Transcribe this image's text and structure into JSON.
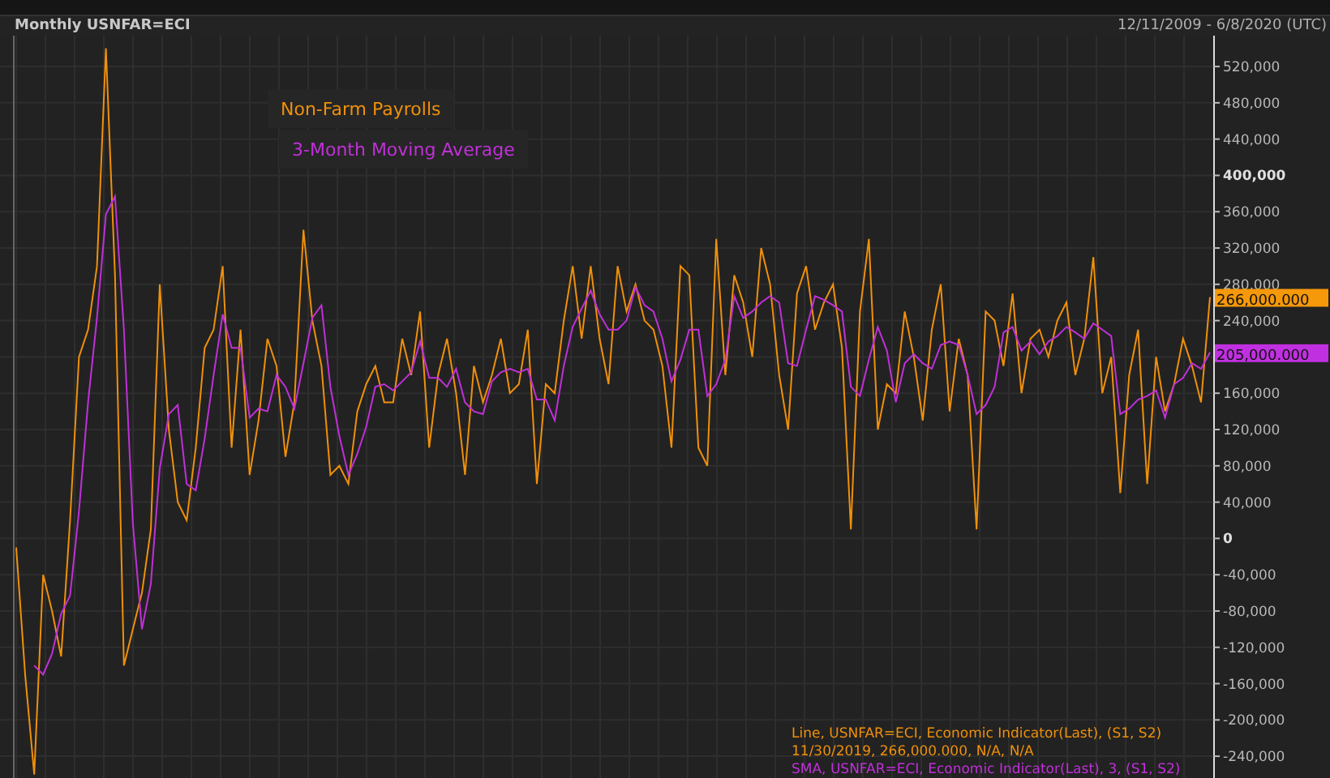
{
  "header": {
    "title": "Monthly USNFAR=ECI",
    "date_range": "12/11/2009 - 6/8/2020 (UTC)"
  },
  "chart": {
    "last_value_labels": [
      {
        "text": "266,000.000",
        "color": "#f5980a"
      },
      {
        "text": "205,000.000",
        "color": "#c030e0"
      }
    ],
    "info_lines": [
      {
        "text": "Line, USNFAR=ECI, Economic Indicator(Last), (S1, S2)",
        "color": "#f0900a"
      },
      {
        "text": "11/30/2019, 266,000.000, N/A, N/A",
        "color": "#f0900a"
      },
      {
        "text": "SMA, USNFAR=ECI, Economic Indicator(Last), 3, (S1, S2)",
        "color": "#c030d8"
      }
    ],
    "chart_data": {
      "type": "line",
      "grid": true,
      "ylim": [
        -264000,
        554000
      ],
      "yticks": [
        {
          "value": 520000,
          "label": "520,000"
        },
        {
          "value": 480000,
          "label": "480,000"
        },
        {
          "value": 440000,
          "label": "440,000"
        },
        {
          "value": 400000,
          "label": "400,000"
        },
        {
          "value": 360000,
          "label": "360,000"
        },
        {
          "value": 320000,
          "label": "320,000"
        },
        {
          "value": 280000,
          "label": "280,000"
        },
        {
          "value": 240000,
          "label": "240,000"
        },
        {
          "value": 160000,
          "label": "160,000"
        },
        {
          "value": 120000,
          "label": "120,000"
        },
        {
          "value": 80000,
          "label": "80,000"
        },
        {
          "value": 40000,
          "label": "40,000"
        },
        {
          "value": 0,
          "label": "0"
        },
        {
          "value": -40000,
          "label": "-40,000"
        },
        {
          "value": -80000,
          "label": "-80,000"
        },
        {
          "value": -120000,
          "label": "-120,000"
        },
        {
          "value": -160000,
          "label": "-160,000"
        },
        {
          "value": -200000,
          "label": "-200,000"
        },
        {
          "value": -240000,
          "label": "-240,000"
        }
      ],
      "series": [
        {
          "name": "Non-Farm Payrolls",
          "color": "#f0900a",
          "values": [
            -10000,
            -150000,
            -260000,
            -40000,
            -80000,
            -130000,
            20000,
            200000,
            230000,
            300000,
            540000,
            290000,
            -140000,
            -100000,
            -60000,
            10000,
            280000,
            120000,
            40000,
            20000,
            100000,
            210000,
            230000,
            300000,
            100000,
            230000,
            70000,
            130000,
            220000,
            190000,
            90000,
            150000,
            340000,
            240000,
            190000,
            70000,
            80000,
            60000,
            140000,
            170000,
            190000,
            150000,
            150000,
            220000,
            180000,
            250000,
            100000,
            180000,
            220000,
            160000,
            70000,
            190000,
            150000,
            180000,
            220000,
            160000,
            170000,
            230000,
            60000,
            170000,
            160000,
            240000,
            300000,
            220000,
            300000,
            220000,
            170000,
            300000,
            250000,
            280000,
            240000,
            230000,
            190000,
            100000,
            300000,
            290000,
            100000,
            80000,
            330000,
            180000,
            290000,
            260000,
            200000,
            320000,
            280000,
            180000,
            120000,
            270000,
            300000,
            230000,
            260000,
            280000,
            210000,
            10000,
            250000,
            330000,
            120000,
            170000,
            160000,
            250000,
            200000,
            130000,
            230000,
            280000,
            140000,
            220000,
            180000,
            10000,
            250000,
            240000,
            190000,
            270000,
            160000,
            220000,
            230000,
            200000,
            240000,
            260000,
            180000,
            220000,
            310000,
            160000,
            200000,
            50000,
            180000,
            230000,
            60000,
            200000,
            140000,
            170000,
            220000,
            190000,
            150000,
            266000
          ]
        },
        {
          "name": "3-Month Moving Average",
          "color": "#c030d8",
          "values": [
            null,
            null,
            -140000,
            -150000,
            -127000,
            -83000,
            -63000,
            30000,
            150000,
            243000,
            357000,
            377000,
            230000,
            17000,
            -100000,
            -50000,
            77000,
            137000,
            147000,
            60000,
            53000,
            110000,
            180000,
            247000,
            210000,
            210000,
            133000,
            143000,
            140000,
            180000,
            167000,
            143000,
            193000,
            243000,
            257000,
            167000,
            113000,
            70000,
            93000,
            123000,
            167000,
            170000,
            163000,
            173000,
            183000,
            217000,
            177000,
            177000,
            167000,
            187000,
            150000,
            140000,
            137000,
            173000,
            183000,
            187000,
            183000,
            187000,
            153000,
            153000,
            130000,
            190000,
            233000,
            253000,
            273000,
            247000,
            230000,
            230000,
            240000,
            277000,
            257000,
            250000,
            220000,
            173000,
            197000,
            230000,
            230000,
            157000,
            170000,
            197000,
            267000,
            243000,
            250000,
            260000,
            267000,
            260000,
            193000,
            190000,
            230000,
            267000,
            263000,
            257000,
            250000,
            167000,
            157000,
            197000,
            233000,
            207000,
            150000,
            193000,
            203000,
            193000,
            187000,
            213000,
            217000,
            213000,
            180000,
            137000,
            147000,
            167000,
            227000,
            233000,
            207000,
            217000,
            203000,
            217000,
            223000,
            233000,
            227000,
            220000,
            237000,
            230000,
            223000,
            137000,
            143000,
            153000,
            157000,
            163000,
            133000,
            170000,
            177000,
            193000,
            187000,
            205000
          ]
        }
      ]
    }
  }
}
